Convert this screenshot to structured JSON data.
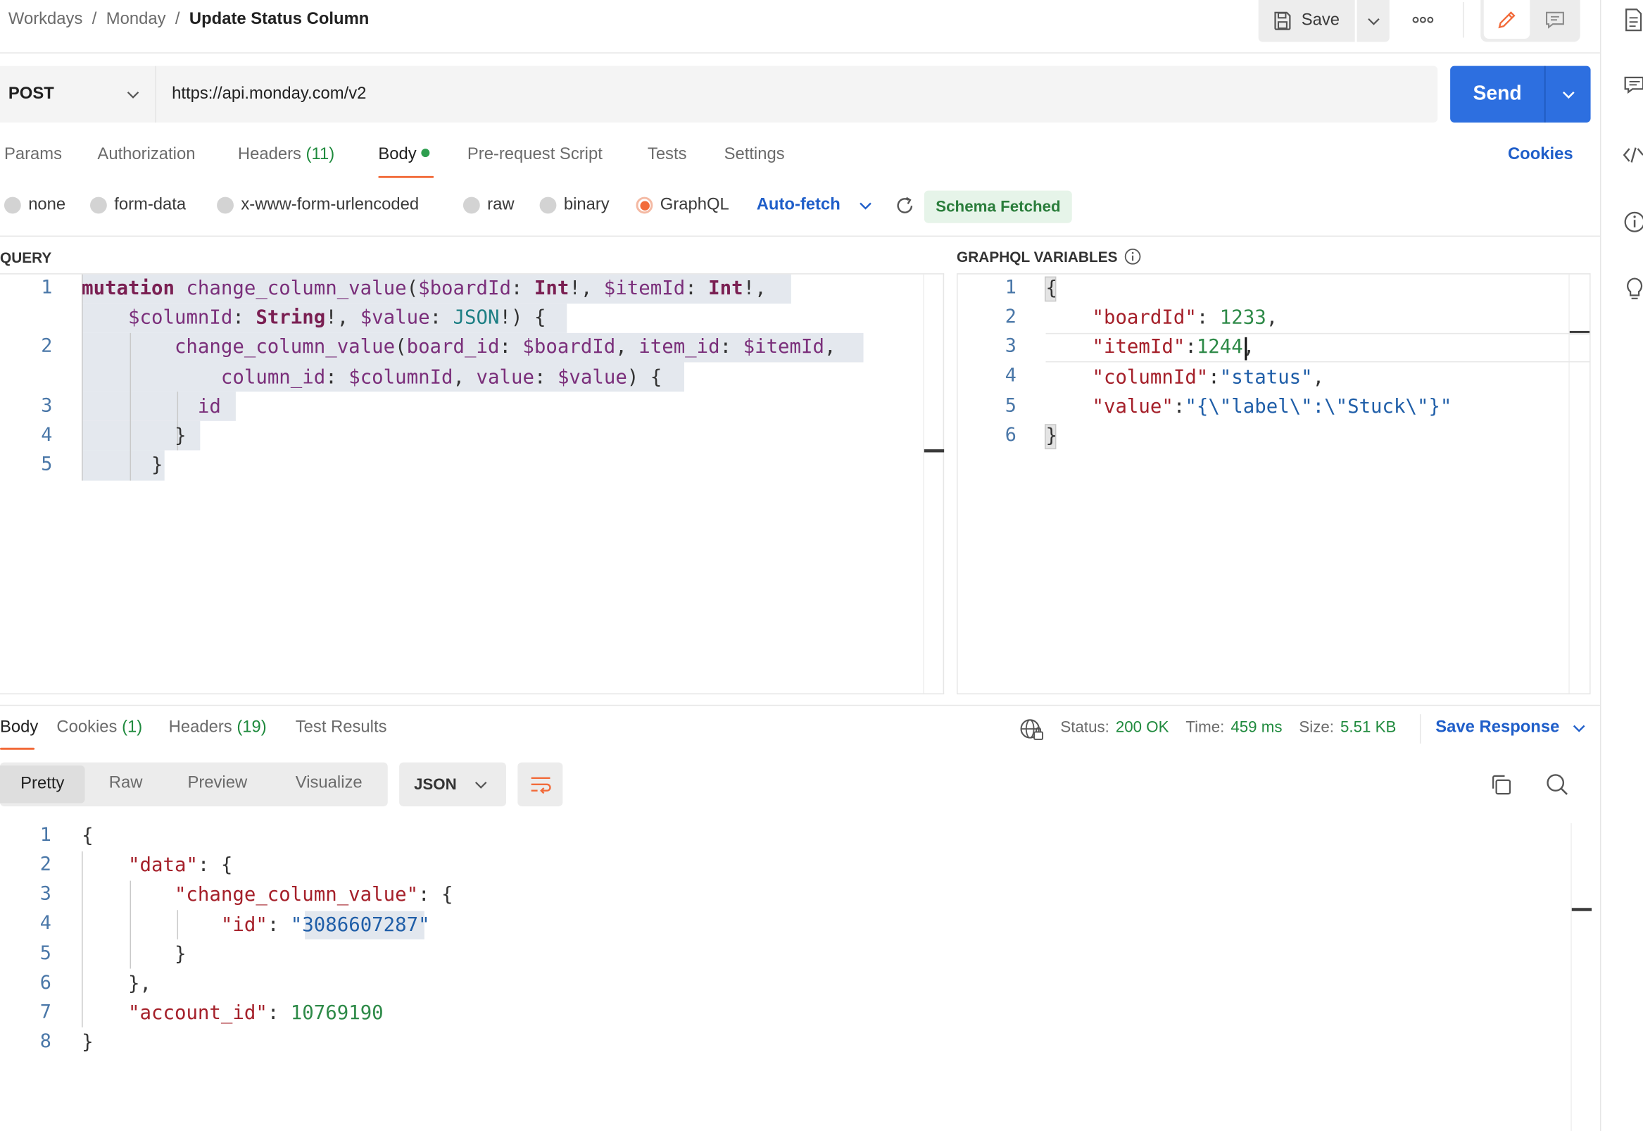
{
  "breadcrumb": {
    "workspace": "Workdays",
    "collection": "Monday",
    "request": "Update Status Column",
    "sep": "/"
  },
  "toolbar": {
    "save_label": "Save"
  },
  "request": {
    "method": "POST",
    "url": "https://api.monday.com/v2",
    "send_label": "Send"
  },
  "tabs": {
    "params": "Params",
    "authorization": "Authorization",
    "headers": "Headers",
    "headers_count": "(11)",
    "body": "Body",
    "prerequest": "Pre-request Script",
    "tests": "Tests",
    "settings": "Settings",
    "cookies": "Cookies"
  },
  "body_types": {
    "none": "none",
    "form_data": "form-data",
    "urlencoded": "x-www-form-urlencoded",
    "raw": "raw",
    "binary": "binary",
    "graphql": "GraphQL",
    "autofetch": "Auto-fetch",
    "schema_badge": "Schema Fetched"
  },
  "query_panel": {
    "title": "QUERY",
    "line_numbers": [
      "1",
      "2",
      "3",
      "4",
      "5"
    ]
  },
  "variables_panel": {
    "title": "GRAPHQL VARIABLES",
    "line_numbers": [
      "1",
      "2",
      "3",
      "4",
      "5",
      "6"
    ]
  },
  "response_tabs": {
    "body": "Body",
    "cookies": "Cookies",
    "cookies_count": "(1)",
    "headers": "Headers",
    "headers_count": "(19)",
    "test_results": "Test Results"
  },
  "response_meta": {
    "status_label": "Status:",
    "status_value": "200 OK",
    "time_label": "Time:",
    "time_value": "459 ms",
    "size_label": "Size:",
    "size_value": "5.51 KB",
    "save_response": "Save Response"
  },
  "view_modes": {
    "pretty": "Pretty",
    "raw": "Raw",
    "preview": "Preview",
    "visualize": "Visualize",
    "format": "JSON"
  },
  "response_body": {
    "line_numbers": [
      "1",
      "2",
      "3",
      "4",
      "5",
      "6",
      "7",
      "8"
    ]
  },
  "icons": {
    "save": "floppy-disk-icon",
    "more": "more-horizontal-icon",
    "edit": "pencil-icon",
    "comment": "comment-icon",
    "refresh": "refresh-icon",
    "info": "info-icon",
    "globe": "globe-lock-icon",
    "wrap": "wrap-lines-icon",
    "copy": "copy-icon",
    "search": "search-icon"
  },
  "colors": {
    "accent": "#f26b3a",
    "send": "#2d6fe0",
    "link": "#1f5ec9",
    "success": "#1f8a3d"
  }
}
